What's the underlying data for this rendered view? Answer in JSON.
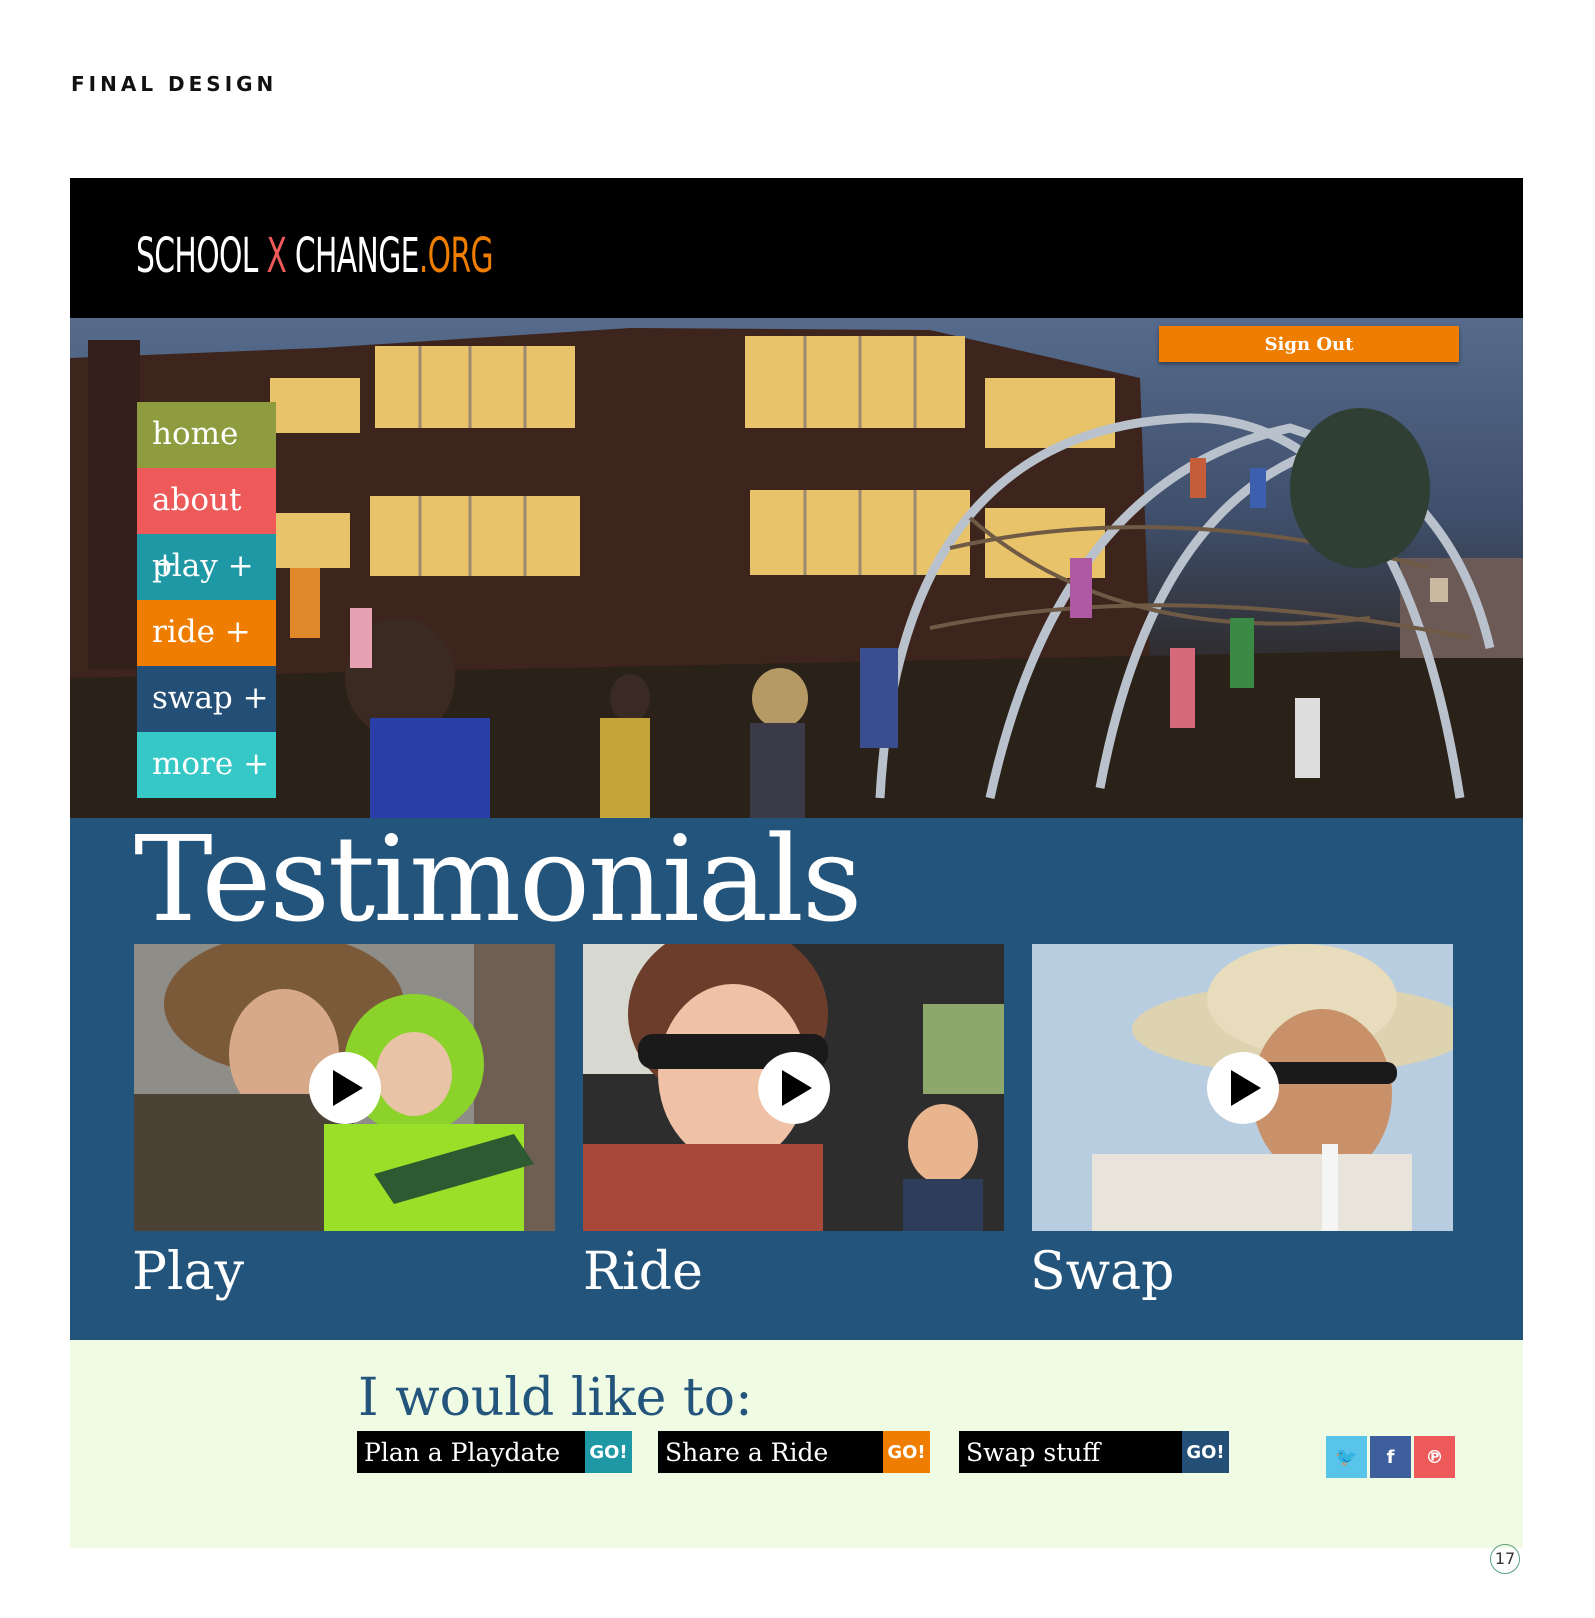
{
  "page_label": "FINAL DESIGN",
  "page_number": "17",
  "logo": {
    "school": "SCHOOL",
    "x": "X",
    "change": "CHANGE",
    "org": ".ORG"
  },
  "header": {
    "sign_out": "Sign Out"
  },
  "nav": {
    "home": "home",
    "about": "about +",
    "play": "play +",
    "ride": "ride +",
    "swap": "swap +",
    "more": "more +"
  },
  "testimonials": {
    "title": "Testimonials",
    "cards": [
      {
        "label": "Play"
      },
      {
        "label": "Ride"
      },
      {
        "label": "Swap"
      }
    ]
  },
  "cta": {
    "title": "I would like to:",
    "actions": [
      {
        "value": "Plan a Playdate",
        "go": "GO!",
        "color": "#1f98a6"
      },
      {
        "value": "Share a Ride",
        "go": "GO!",
        "color": "#ef7d00"
      },
      {
        "value": "Swap stuff",
        "go": "GO!",
        "color": "#234e76"
      }
    ]
  },
  "social": [
    {
      "icon": "twitter-icon",
      "glyph": "🐦",
      "color": "#59c4ea"
    },
    {
      "icon": "facebook-icon",
      "glyph": "f",
      "color": "#3e5e9e"
    },
    {
      "icon": "pinterest-icon",
      "glyph": "℗",
      "color": "#ee5a5a"
    }
  ],
  "colors": {
    "brand_orange": "#ef7d00",
    "brand_red": "#ee5a5a",
    "brand_navy": "#23547b",
    "cta_background": "#f0fbe4"
  }
}
